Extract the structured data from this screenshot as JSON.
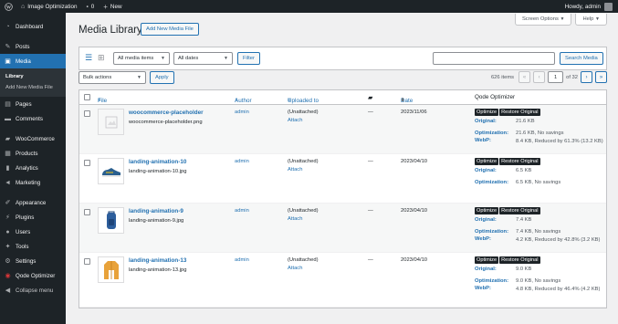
{
  "admin_bar": {
    "site_name": "Image Optimization",
    "comments_count": "0",
    "new_label": "New",
    "howdy": "Howdy, admin"
  },
  "sidebar": {
    "items": [
      {
        "label": "Dashboard",
        "icon": "dashboard-icon"
      },
      {
        "label": "Posts",
        "icon": "pin-icon"
      },
      {
        "label": "Media",
        "icon": "media-icon"
      },
      {
        "label": "Pages",
        "icon": "pages-icon"
      },
      {
        "label": "Comments",
        "icon": "comment-icon"
      },
      {
        "label": "WooCommerce",
        "icon": "woocommerce-icon"
      },
      {
        "label": "Products",
        "icon": "products-icon"
      },
      {
        "label": "Analytics",
        "icon": "analytics-icon"
      },
      {
        "label": "Marketing",
        "icon": "megaphone-icon"
      },
      {
        "label": "Appearance",
        "icon": "brush-icon"
      },
      {
        "label": "Plugins",
        "icon": "plugin-icon"
      },
      {
        "label": "Users",
        "icon": "user-icon"
      },
      {
        "label": "Tools",
        "icon": "wrench-icon"
      },
      {
        "label": "Settings",
        "icon": "settings-icon"
      },
      {
        "label": "Qode Optimizer",
        "icon": "qode-icon"
      },
      {
        "label": "Collapse menu",
        "icon": "collapse-icon"
      }
    ],
    "media_sub": [
      "Library",
      "Add New Media File"
    ]
  },
  "screen_options": "Screen Options",
  "help": "Help",
  "page_title": "Media Library",
  "add_new": "Add New Media File",
  "filters": {
    "media_items": "All media items",
    "dates": "All dates",
    "filter_btn": "Filter",
    "search_btn": "Search Media",
    "search_value": ""
  },
  "bulk": {
    "action": "Bulk actions",
    "apply": "Apply"
  },
  "pagination": {
    "items": "626 items",
    "first": "«",
    "prev": "‹",
    "current": "1",
    "of": "of 32",
    "next": "›",
    "last": "»"
  },
  "columns": {
    "file": "File",
    "author": "Author",
    "uploaded_to": "Uploaded to",
    "date": "Date",
    "qode": "Qode Optimizer"
  },
  "rows": [
    {
      "title": "woocommerce-placeholder",
      "filename": "woocommerce-placeholder.png",
      "author": "admin",
      "uploaded": "(Unattached)",
      "attach": "Attach",
      "comments": "—",
      "date": "2023/11/06",
      "optimize": "Optimize",
      "restore": "Restore Original",
      "original_label": "Original:",
      "original": "21.6 KB",
      "optimization_label": "Optimization:",
      "optimization": "21.6 KB, No savings",
      "webp_label": "WebP:",
      "webp": "8.4 KB, Reduced by 61.3% (13.2 KB)"
    },
    {
      "title": "landing-animation-10",
      "filename": "landing-animation-10.jpg",
      "author": "admin",
      "uploaded": "(Unattached)",
      "attach": "Attach",
      "comments": "—",
      "date": "2023/04/10",
      "optimize": "Optimize",
      "restore": "Restore Original",
      "original_label": "Original:",
      "original": "6.5 KB",
      "optimization_label": "Optimization:",
      "optimization": "6.5 KB, No savings",
      "webp_label": "",
      "webp": ""
    },
    {
      "title": "landing-animation-9",
      "filename": "landing-animation-9.jpg",
      "author": "admin",
      "uploaded": "(Unattached)",
      "attach": "Attach",
      "comments": "—",
      "date": "2023/04/10",
      "optimize": "Optimize",
      "restore": "Restore Original",
      "original_label": "Original:",
      "original": "7.4 KB",
      "optimization_label": "Optimization:",
      "optimization": "7.4 KB, No savings",
      "webp_label": "WebP:",
      "webp": "4.2 KB, Reduced by 42.8% (3.2 KB)"
    },
    {
      "title": "landing-animation-13",
      "filename": "landing-animation-13.jpg",
      "author": "admin",
      "uploaded": "(Unattached)",
      "attach": "Attach",
      "comments": "—",
      "date": "2023/04/10",
      "optimize": "Optimize",
      "restore": "Restore Original",
      "original_label": "Original:",
      "original": "9.0 KB",
      "optimization_label": "Optimization:",
      "optimization": "9.0 KB, No savings",
      "webp_label": "WebP:",
      "webp": "4.8 KB, Reduced by 46.4% (4.2 KB)"
    }
  ]
}
